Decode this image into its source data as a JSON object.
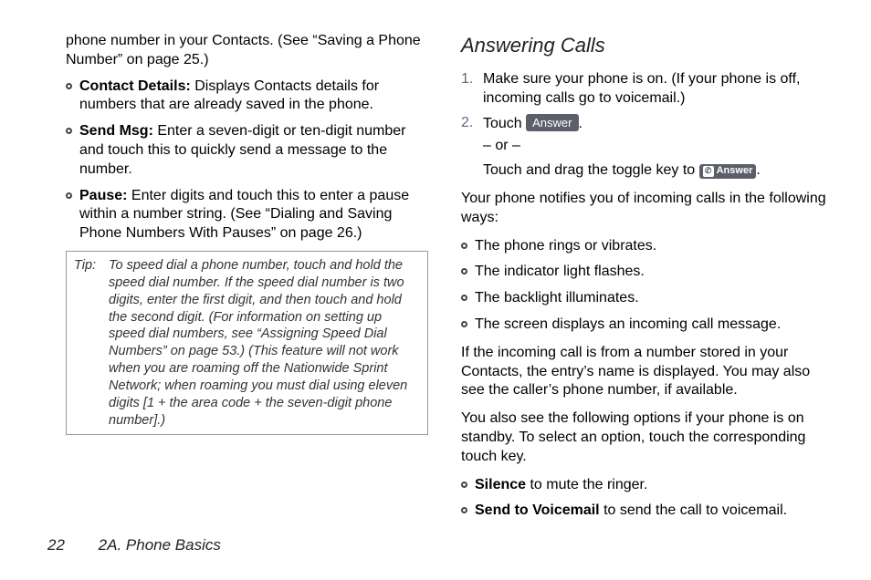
{
  "left_column": {
    "intro_text": "phone number in your Contacts. (See “Saving a Phone Number” on page 25.)",
    "bullets": [
      {
        "bold": "Contact Details:",
        "text": " Displays Contacts details for numbers that are already saved in the phone."
      },
      {
        "bold": "Send Msg:",
        "text": " Enter a seven-digit or ten-digit number and touch this to quickly send a message to the number."
      },
      {
        "bold": "Pause:",
        "text": " Enter digits and touch this to enter a pause within a number string. (See “Dialing and Saving Phone Numbers With Pauses” on page 26.)"
      }
    ],
    "tip": {
      "label": "Tip:",
      "text": "To speed dial a phone number, touch and hold the speed dial number. If the speed dial number is two digits, enter the first digit, and then touch and hold the second digit. (For information on setting up speed dial numbers, see “Assigning Speed Dial Numbers” on page 53.) (This feature will not work when you are roaming off the Nationwide Sprint Network; when roaming you must dial using eleven digits [1 + the area code + the seven-digit phone number].)"
    }
  },
  "right_column": {
    "heading": "Answering Calls",
    "steps": {
      "step1": "Make sure your phone is on. (If your phone is off, incoming calls go to voicemail.)",
      "step2_prefix": "Touch ",
      "answer_button_label": "Answer",
      "step2_suffix": ".",
      "or_text": "– or –",
      "toggle_text_prefix": "Touch and drag the toggle key to ",
      "answer_icon_label": "Answer",
      "toggle_text_suffix": "."
    },
    "notify_intro": "Your phone notifies you of incoming calls in the following ways:",
    "notify_bullets": [
      "The phone rings or vibrates.",
      "The indicator light flashes.",
      "The backlight illuminates.",
      "The screen displays an incoming call message."
    ],
    "contacts_para": "If the incoming call is from a number stored in your Contacts, the entry’s name is displayed. You may also see the caller’s phone number, if available.",
    "standby_para": "You also see the following options if your phone is on standby. To select an option, touch the corresponding touch key.",
    "option_bullets": [
      {
        "bold": "Silence",
        "text": " to mute the ringer."
      },
      {
        "bold": "Send to Voicemail",
        "text": " to send the call to voicemail."
      }
    ]
  },
  "footer": {
    "page_number": "22",
    "section": "2A. Phone Basics"
  }
}
